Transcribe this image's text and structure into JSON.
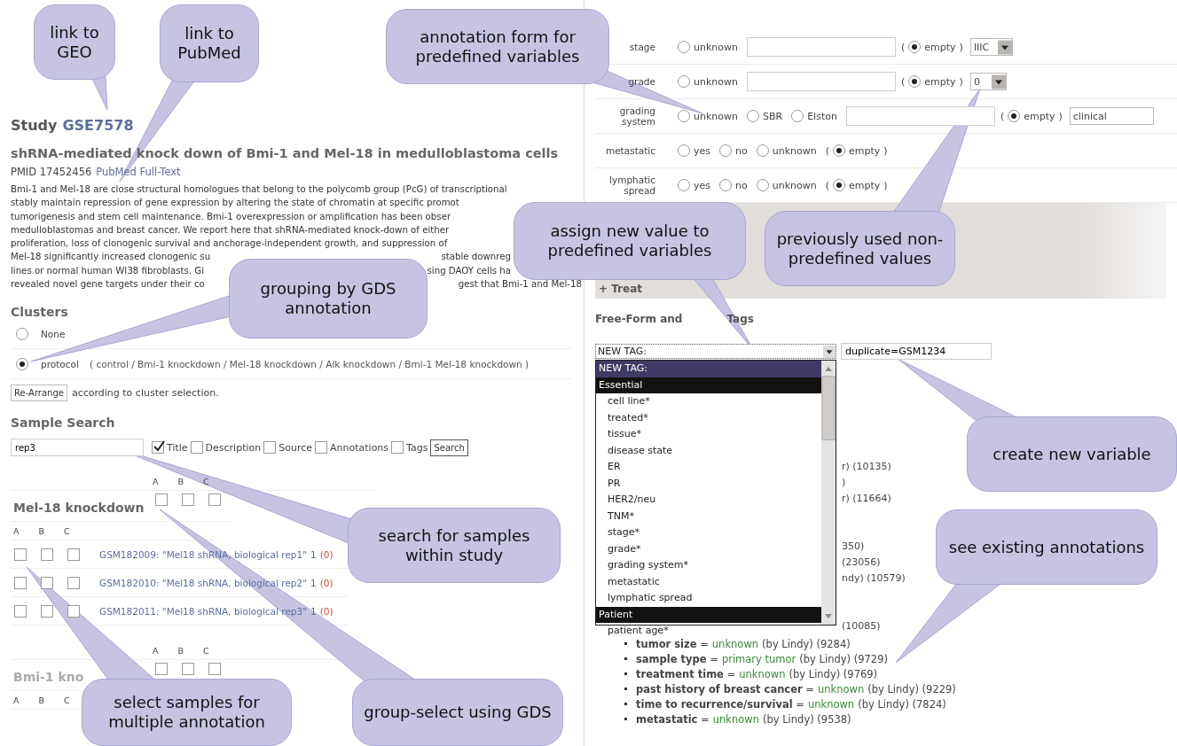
{
  "study": {
    "label": "Study",
    "id": "GSE7578"
  },
  "title": "shRNA-mediated knock down of Bmi-1 and Mel-18 in medulloblastoma cells",
  "pmid": {
    "label": "PMID 17452456",
    "link": "PubMed Full-Text"
  },
  "abstract_lines": [
    {
      "left": "Bmi-1 and Mel-18 are close structural homologues that belong to the polycomb group (PcG) of transcriptional"
    },
    {
      "left": "stably maintain repression of gene expression by altering the state of chromatin at specific promot"
    },
    {
      "left": "tumorigenesis and stem cell maintenance. Bmi-1 overexpression or amplification has been obser"
    },
    {
      "left": "medulloblastomas and breast cancer. We report here that shRNA-mediated knock-down of either"
    },
    {
      "left": "proliferation, loss of clonogenic survival and anchorage-independent growth, and suppression of"
    },
    {
      "left": "Mel-18 significantly increased clonogenic su",
      "right": "stable downreg"
    },
    {
      "left": "lines or normal human WI38 fibroblasts. Gi",
      "right": "sing DAOY cells ha"
    },
    {
      "left": "revealed novel gene targets under their co",
      "right": "gest that Bmi-1 and Mel-18"
    }
  ],
  "clusters": {
    "heading": "Clusters",
    "options": [
      {
        "label": "None",
        "selected": false
      },
      {
        "label": "protocol",
        "selected": true,
        "values": "( control / Bmi-1 knockdown / Mel-18 knockdown / Alk knockdown / Bmi-1 Mel-18 knockdown )"
      }
    ]
  },
  "rearrange": {
    "button": "Re-Arrange",
    "text": "according to cluster selection."
  },
  "sample_search": {
    "heading": "Sample Search",
    "value": "rep3",
    "filters": [
      {
        "label": "Title",
        "checked": true
      },
      {
        "label": "Description",
        "checked": false
      },
      {
        "label": "Source",
        "checked": false
      },
      {
        "label": "Annotations",
        "checked": false
      },
      {
        "label": "Tags",
        "checked": false
      }
    ],
    "button": "Search"
  },
  "groups": [
    {
      "column_headers": [
        "A",
        "B",
        "C"
      ],
      "name": "Mel-18 knockdown",
      "group_checks": [
        false,
        false,
        false
      ],
      "sample_headers": [
        "A",
        "B",
        "C"
      ],
      "samples": [
        {
          "title": "GSM182009: \"Mel18 shRNA, biological rep1\"",
          "count": "1",
          "pending": "(0)",
          "checks": [
            false,
            false,
            false
          ]
        },
        {
          "title": "GSM182010: \"Mel18 shRNA, biological rep2\"",
          "count": "1",
          "pending": "(0)",
          "checks": [
            false,
            false,
            false
          ]
        },
        {
          "title": "GSM182011: \"Mel18 shRNA, biological rep3\"",
          "count": "1",
          "pending": "(0)",
          "checks": [
            false,
            false,
            false
          ]
        }
      ]
    },
    {
      "column_headers": [
        "A",
        "B",
        "C"
      ],
      "name": "Bmi-1 kno",
      "group_checks": [
        false,
        false,
        false
      ],
      "sample_headers": [
        "A",
        "B",
        "C"
      ]
    }
  ],
  "fields": [
    {
      "label": "stage",
      "options": [
        {
          "label": "unknown",
          "selected": false
        }
      ],
      "text_field": true,
      "empty": {
        "open": "(",
        "label": "empty",
        "close": ")",
        "selected": true
      },
      "previous": {
        "value": "IIIC",
        "dropdown": true
      }
    },
    {
      "label": "grade",
      "options": [
        {
          "label": "unknown",
          "selected": false
        }
      ],
      "text_field": true,
      "empty": {
        "open": "(",
        "label": "empty",
        "close": ")",
        "selected": true
      },
      "previous": {
        "value": "0",
        "dropdown": true
      }
    },
    {
      "label": "grading system",
      "options": [
        {
          "label": "unknown",
          "selected": false
        },
        {
          "label": "SBR",
          "selected": false
        },
        {
          "label": "Elston",
          "selected": false
        }
      ],
      "text_field": true,
      "empty": {
        "open": "(",
        "label": "empty",
        "close": ")",
        "selected": true
      },
      "previous": {
        "value": "clinical",
        "dropdown": false
      }
    },
    {
      "label": "metastatic",
      "options": [
        {
          "label": "yes",
          "selected": false
        },
        {
          "label": "no",
          "selected": false
        },
        {
          "label": "unknown",
          "selected": false
        }
      ],
      "text_field": false,
      "empty": {
        "open": "(",
        "label": "empty",
        "close": ")",
        "selected": true
      }
    },
    {
      "label": "lymphatic spread",
      "options": [
        {
          "label": "yes",
          "selected": false
        },
        {
          "label": "no",
          "selected": false
        },
        {
          "label": "unknown",
          "selected": false
        }
      ],
      "text_field": false,
      "empty": {
        "open": "(",
        "label": "empty",
        "close": ")",
        "selected": true
      }
    }
  ],
  "treatment_section": {
    "label": "+ Treat"
  },
  "tags": {
    "heading_left": "Free-Form and",
    "heading_right": "Tags",
    "select_value": "NEW TAG:",
    "new_value": "duplicate=GSM1234",
    "dropdown_items": [
      {
        "label": "NEW TAG:",
        "kind": "option",
        "selected": true
      },
      {
        "label": "Essential",
        "kind": "group",
        "selected": false
      },
      {
        "label": "cell line*",
        "kind": "option",
        "selected": false
      },
      {
        "label": "treated*",
        "kind": "option",
        "selected": false
      },
      {
        "label": "tissue*",
        "kind": "option",
        "selected": false
      },
      {
        "label": "disease state",
        "kind": "option",
        "selected": false
      },
      {
        "label": "ER",
        "kind": "option",
        "selected": false
      },
      {
        "label": "PR",
        "kind": "option",
        "selected": false
      },
      {
        "label": "HER2/neu",
        "kind": "option",
        "selected": false
      },
      {
        "label": "TNM*",
        "kind": "option",
        "selected": false
      },
      {
        "label": "stage*",
        "kind": "option",
        "selected": false
      },
      {
        "label": "grade*",
        "kind": "option",
        "selected": false
      },
      {
        "label": "grading system*",
        "kind": "option",
        "selected": false
      },
      {
        "label": "metastatic",
        "kind": "option",
        "selected": false
      },
      {
        "label": "lymphatic spread",
        "kind": "option",
        "selected": false
      },
      {
        "label": "Patient",
        "kind": "group",
        "selected": false
      },
      {
        "label": "patient age*",
        "kind": "option",
        "selected": false
      }
    ]
  },
  "annotation_fragments": [
    "r) (10135)",
    ")",
    "r) (11664)",
    "350)",
    "(23056)",
    "ndy) (10579)",
    "(10085)"
  ],
  "annotations": [
    {
      "label": "**tumor size** =",
      "value": "unknown",
      "note": "(by Lindy) (9284)"
    },
    {
      "label": "**sample type** =",
      "value": "primary tumor",
      "note": "(by Lindy) (9729)"
    },
    {
      "label": "**treatment time** =",
      "value": "unknown",
      "note": "(by Lindy) (9769)"
    },
    {
      "label": "**past history of breast cancer** =",
      "value": "unknown",
      "note": "(by Lindy) (9229)"
    },
    {
      "label": "**time to recurrence/survival** =",
      "value": "unknown",
      "note": "(by Lindy) (7824)"
    },
    {
      "label": "**metastatic** =",
      "value": "unknown",
      "note": "(by Lindy) (9538)"
    }
  ],
  "callouts": [
    {
      "text": "link to GEO"
    },
    {
      "text": "link to PubMed"
    },
    {
      "text": "annotation form for predefined variables"
    },
    {
      "text": "grouping by GDS annotation"
    },
    {
      "text": "assign new value to predefined variables"
    },
    {
      "text": "previously used non-predefined values"
    },
    {
      "text": "create new variable"
    },
    {
      "text": "search for samples within study"
    },
    {
      "text": "see existing annotations"
    },
    {
      "text": "select samples for multiple annotation"
    },
    {
      "text": "group-select using GDS"
    }
  ]
}
